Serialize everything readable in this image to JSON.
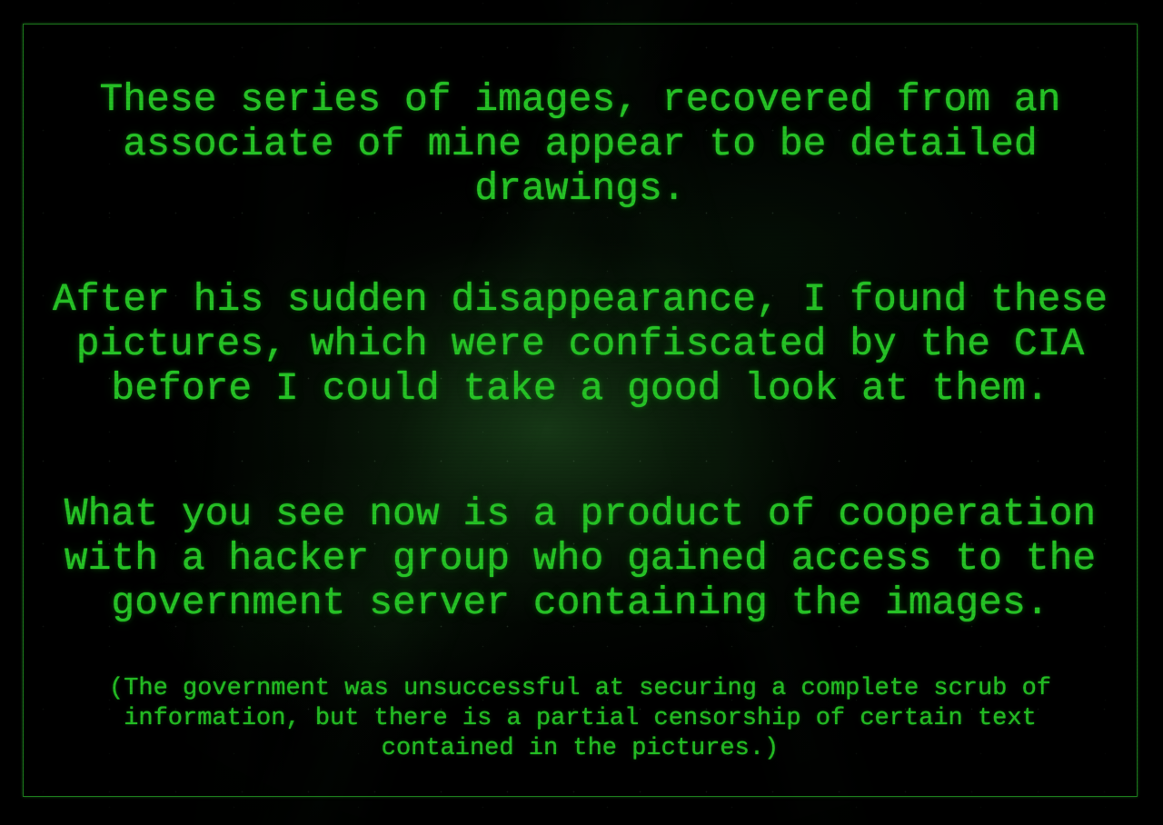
{
  "colors": {
    "background": "#000000",
    "text_green": "#26c426",
    "frame_green": "#1c7a1c",
    "glow_green": "#3cff3c"
  },
  "frame": {
    "label": "green-terminal-border"
  },
  "screen": {
    "paragraphs": [
      "These series of images, recovered from an\nassociate of mine appear to be detailed\ndrawings.",
      "After his sudden disappearance, I found these\npictures, which were confiscated by the CIA\nbefore I could take a good look at them.",
      "What you see now is a product of cooperation\nwith a hacker group who gained access to the\ngovernment server containing the images."
    ],
    "note": "(The government was unsuccessful at securing a complete scrub of\ninformation, but there is a partial censorship of certain text\ncontained in the pictures.)"
  }
}
